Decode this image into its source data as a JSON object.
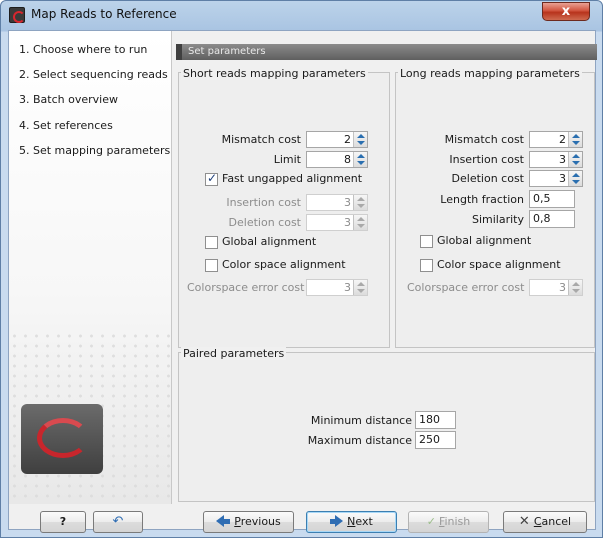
{
  "window": {
    "title": "Map Reads to Reference",
    "close_label": "x"
  },
  "steps": [
    {
      "label": "1.  Choose where to run"
    },
    {
      "label": "2.  Select sequencing reads"
    },
    {
      "label": "3.  Batch overview"
    },
    {
      "label": "4.  Set references"
    },
    {
      "label": "5.  Set mapping parameters"
    }
  ],
  "header": {
    "title": "Set parameters"
  },
  "short_reads": {
    "title": "Short reads mapping parameters",
    "mismatch_cost_label": "Mismatch cost",
    "mismatch_cost": "2",
    "limit_label": "Limit",
    "limit": "8",
    "fast_ungapped_label": "Fast ungapped alignment",
    "fast_ungapped_checked": true,
    "insertion_cost_label": "Insertion cost",
    "insertion_cost": "3",
    "deletion_cost_label": "Deletion cost",
    "deletion_cost": "3",
    "global_alignment_label": "Global alignment",
    "global_alignment_checked": false,
    "color_space_label": "Color space alignment",
    "color_space_checked": false,
    "colorspace_error_label": "Colorspace error cost",
    "colorspace_error": "3"
  },
  "long_reads": {
    "title": "Long reads mapping parameters",
    "mismatch_cost_label": "Mismatch cost",
    "mismatch_cost": "2",
    "insertion_cost_label": "Insertion cost",
    "insertion_cost": "3",
    "deletion_cost_label": "Deletion cost",
    "deletion_cost": "3",
    "length_fraction_label": "Length fraction",
    "length_fraction": "0,5",
    "similarity_label": "Similarity",
    "similarity": "0,8",
    "global_alignment_label": "Global alignment",
    "global_alignment_checked": false,
    "color_space_label": "Color space alignment",
    "color_space_checked": false,
    "colorspace_error_label": "Colorspace error cost",
    "colorspace_error": "3"
  },
  "paired": {
    "title": "Paired parameters",
    "min_distance_label": "Minimum distance",
    "min_distance": "180",
    "max_distance_label": "Maximum distance",
    "max_distance": "250"
  },
  "footer": {
    "help_label": "?",
    "reset_icon": "undo-arrow-icon",
    "previous_pre": "",
    "previous_underline": "P",
    "previous_rest": "revious",
    "next_underline": "N",
    "next_rest": "ext",
    "finish_underline": "F",
    "finish_rest": "inish",
    "cancel_underline": "C",
    "cancel_rest": "ancel"
  },
  "colors": {
    "accent": "#2f6db3",
    "logo_red": "#c8262c",
    "titlebar": "#a9c4e2"
  }
}
